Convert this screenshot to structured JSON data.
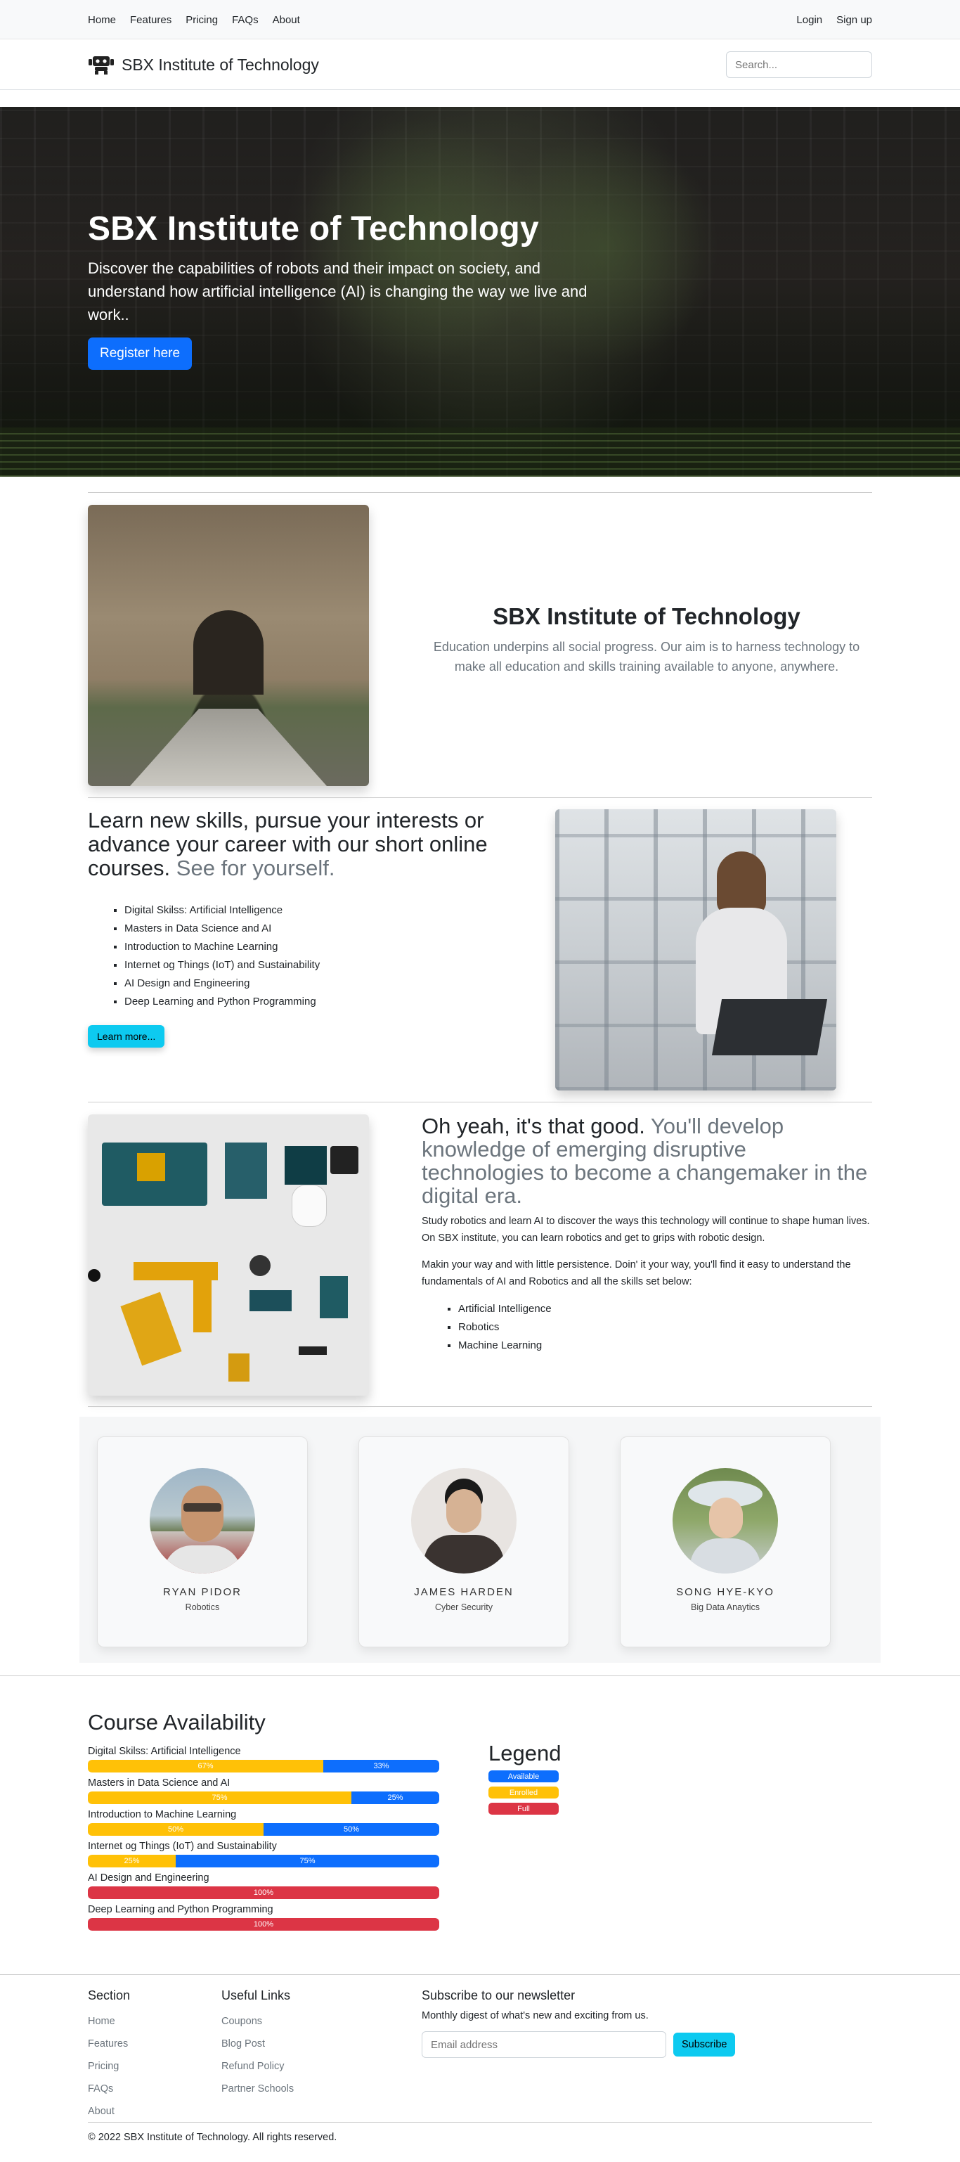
{
  "topnav": {
    "links": [
      "Home",
      "Features",
      "Pricing",
      "FAQs",
      "About"
    ],
    "login": "Login",
    "signup": "Sign up"
  },
  "brandbar": {
    "brand": "SBX Institute of Technology",
    "search_placeholder": "Search..."
  },
  "hero": {
    "title": "SBX Institute of Technology",
    "text": "Discover the capabilities of robots and their impact on society, and understand how artificial intelligence (AI) is changing the way we live and work..",
    "button": "Register here"
  },
  "about": {
    "title": "SBX Institute of Technology",
    "text": "Education underpins all social progress. Our aim is to harness technology to make all education and skills training available to anyone, anywhere."
  },
  "learn": {
    "heading": "Learn new skills, pursue your interests or advance your career with our short online courses.",
    "heading_muted": "See for yourself.",
    "courses": [
      "Digital Skilss: Artificial Intelligence",
      "Masters in Data Science and AI",
      "Introduction to Machine Learning",
      "Internet og Things (IoT) and Sustainability",
      "AI Design and Engineering",
      "Deep Learning and Python Programming"
    ],
    "button": "Learn more..."
  },
  "develop": {
    "heading": "Oh yeah, it's that good.",
    "heading_muted": "You'll develop knowledge of emerging disruptive technologies to become a changemaker in the digital era.",
    "p1": "Study robotics and learn AI to discover the ways this technology will continue to shape human lives. On SBX institute, you can learn robotics and get to grips with robotic design.",
    "p2": "Makin your way and with little persistence. Doin' it your way, you'll find it easy to understand the fundamentals of AI and Robotics and all the skills set below:",
    "skills": [
      "Artificial Intelligence",
      "Robotics",
      "Machine Learning"
    ]
  },
  "team": [
    {
      "name": "RYAN PIDOR",
      "role": "Robotics"
    },
    {
      "name": "JAMES HARDEN",
      "role": "Cyber Security"
    },
    {
      "name": "SONG HYE-KYO",
      "role": "Big Data Anaytics"
    }
  ],
  "availability": {
    "title": "Course Availability",
    "courses": [
      {
        "label": "Digital Skilss: Artificial Intelligence",
        "enrolled": 67,
        "available": 33,
        "full": 0
      },
      {
        "label": "Masters in Data Science and AI",
        "enrolled": 75,
        "available": 25,
        "full": 0
      },
      {
        "label": "Introduction to Machine Learning",
        "enrolled": 50,
        "available": 50,
        "full": 0
      },
      {
        "label": "Internet og Things (IoT) and Sustainability",
        "enrolled": 25,
        "available": 75,
        "full": 0
      },
      {
        "label": "AI Design and Engineering",
        "enrolled": 0,
        "available": 0,
        "full": 100
      },
      {
        "label": "Deep Learning and Python Programming",
        "enrolled": 0,
        "available": 0,
        "full": 100
      }
    ],
    "legend_title": "Legend",
    "legend": {
      "available": "Available",
      "enrolled": "Enrolled",
      "full": "Full"
    }
  },
  "footer": {
    "section_title": "Section",
    "section_links": [
      "Home",
      "Features",
      "Pricing",
      "FAQs",
      "About"
    ],
    "useful_title": "Useful Links",
    "useful_links": [
      "Coupons",
      "Blog Post",
      "Refund Policy",
      "Partner Schools"
    ],
    "newsletter_title": "Subscribe to our newsletter",
    "newsletter_text": "Monthly digest of what's new and exciting from us.",
    "email_placeholder": "Email address",
    "subscribe": "Subscribe",
    "copyright": "© 2022 SBX Institute of Technology. All rights reserved."
  },
  "colors": {
    "primary": "#0d6efd",
    "info": "#0dcaf0",
    "warning": "#ffc107",
    "danger": "#dc3545"
  }
}
